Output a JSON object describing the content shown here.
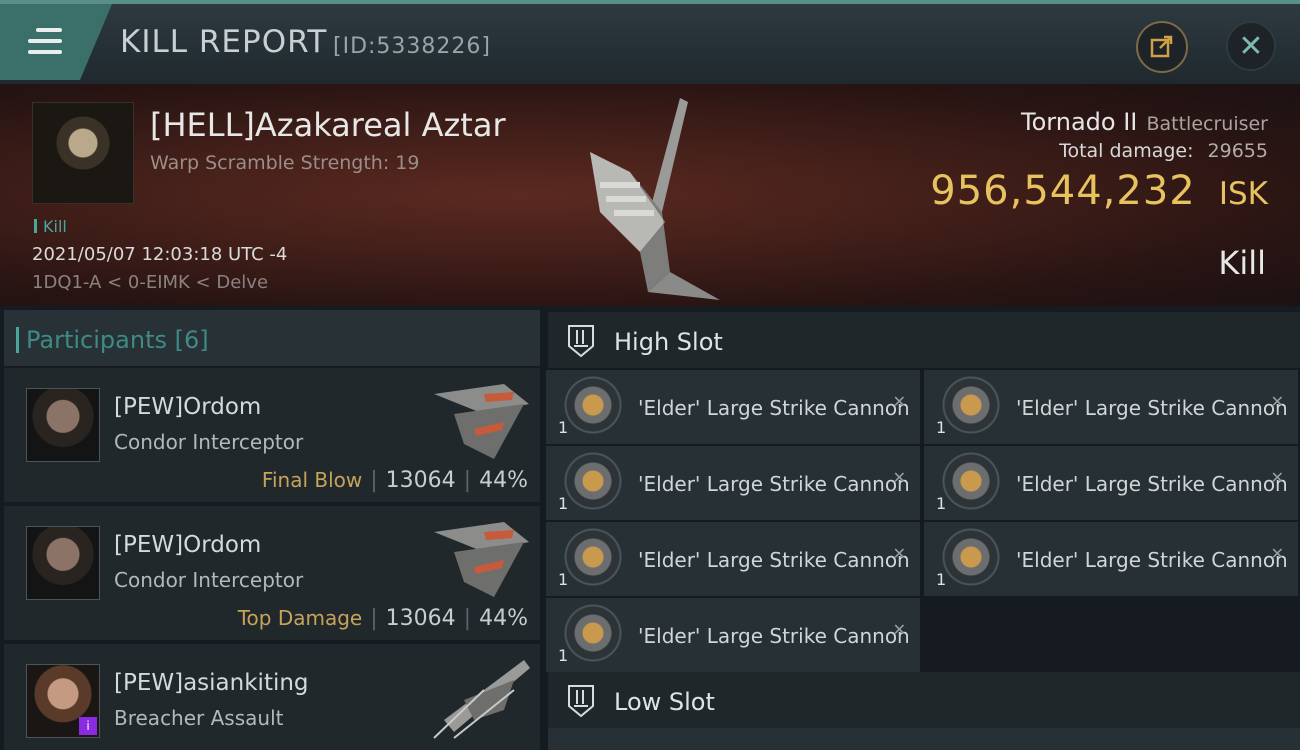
{
  "header": {
    "title": "KILL REPORT",
    "report_id": "[ID:5338226]"
  },
  "victim": {
    "name": "[HELL]Azakareal Aztar",
    "warp_scramble": "Warp Scramble Strength: 19",
    "tag": "Kill",
    "datetime": "2021/05/07 12:03:18 UTC -4",
    "location": "1DQ1-A < 0-EIMK < Delve",
    "ship_name": "Tornado II",
    "ship_class": "Battlecruiser",
    "damage_label": "Total damage:",
    "damage_value": "29655",
    "isk_value": "956,544,232",
    "isk_unit": "ISK",
    "result": "Kill"
  },
  "participants": {
    "label": "Participants [6]",
    "rows": [
      {
        "name": "[PEW]Ordom",
        "ship": "Condor Interceptor",
        "tag": "Final Blow",
        "damage": "13064",
        "percent": "44%"
      },
      {
        "name": "[PEW]Ordom",
        "ship": "Condor Interceptor",
        "tag": "Top Damage",
        "damage": "13064",
        "percent": "44%"
      },
      {
        "name": "[PEW]asiankiting",
        "ship": "Breacher Assault",
        "badge": "i"
      }
    ]
  },
  "slots": {
    "high_label": "High Slot",
    "low_label": "Low Slot",
    "high_modules": [
      {
        "name": "'Elder' Large Strike Cannon",
        "qty": "1"
      },
      {
        "name": "'Elder' Large Strike Cannon",
        "qty": "1"
      },
      {
        "name": "'Elder' Large Strike Cannon",
        "qty": "1"
      },
      {
        "name": "'Elder' Large Strike Cannon",
        "qty": "1"
      },
      {
        "name": "'Elder' Large Strike Cannon",
        "qty": "1"
      },
      {
        "name": "'Elder' Large Strike Cannon",
        "qty": "1"
      },
      {
        "name": "'Elder' Large Strike Cannon",
        "qty": "1"
      }
    ]
  },
  "colors": {
    "accent": "#4aa59b",
    "isk": "#e6c35e",
    "tag_gold": "#c6a35a"
  },
  "icons": {
    "menu": "hamburger-icon",
    "share": "share-icon",
    "close": "close-icon",
    "slot": "high-slot-icon"
  }
}
